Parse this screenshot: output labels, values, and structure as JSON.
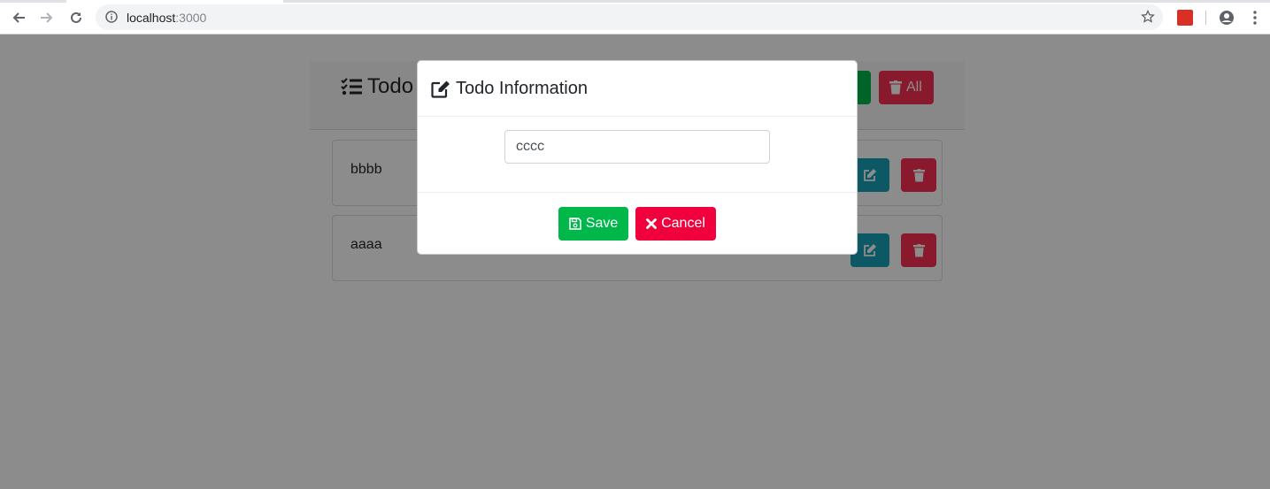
{
  "browser": {
    "url_host": "localhost",
    "url_port": ":3000"
  },
  "app": {
    "title": "Todo",
    "delete_all_label": "All"
  },
  "todos": [
    {
      "text": "bbbb"
    },
    {
      "text": "aaaa"
    }
  ],
  "modal": {
    "title": "Todo Information",
    "input_value": "cccc",
    "save_label": "Save",
    "cancel_label": "Cancel"
  },
  "colors": {
    "success": "#00b74a",
    "danger": "#f93154",
    "info": "#17a2b8"
  },
  "icons": {
    "header": "tasks-icon",
    "modal_title": "edit-icon",
    "save": "save-icon",
    "cancel": "close-icon",
    "edit": "edit-icon",
    "delete": "trash-icon"
  }
}
